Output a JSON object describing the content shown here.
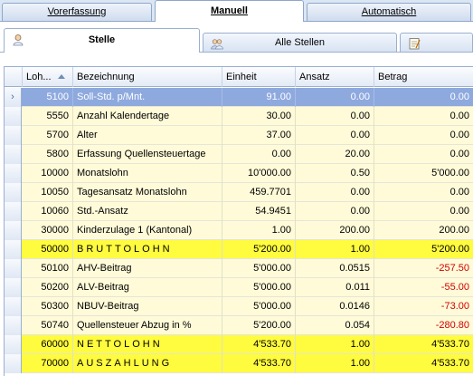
{
  "top_tabs": [
    {
      "label": "Vorerfassung",
      "active": false
    },
    {
      "label": "Manuell",
      "active": true
    },
    {
      "label": "Automatisch",
      "active": false
    }
  ],
  "sub_tabs": [
    {
      "label": "Stelle",
      "icon": "person-icon",
      "active": true
    },
    {
      "label": "Alle Stellen",
      "icon": "people-icon",
      "active": false
    },
    {
      "label": "",
      "icon": "notepad-icon",
      "active": false
    }
  ],
  "columns": [
    "Loh...",
    "Bezeichnung",
    "Einheit",
    "Ansatz",
    "Betrag"
  ],
  "row_indicator": "›",
  "rows": [
    {
      "code": "5100",
      "name": "Soll-Std. p/Mnt.",
      "einheit": "91.00",
      "ansatz": "0.00",
      "betrag": "0.00",
      "type": "selected"
    },
    {
      "code": "5550",
      "name": "Anzahl Kalendertage",
      "einheit": "30.00",
      "ansatz": "0.00",
      "betrag": "0.00",
      "type": "normal"
    },
    {
      "code": "5700",
      "name": "Alter",
      "einheit": "37.00",
      "ansatz": "0.00",
      "betrag": "0.00",
      "type": "normal"
    },
    {
      "code": "5800",
      "name": "Erfassung Quellensteuertage",
      "einheit": "0.00",
      "ansatz": "20.00",
      "betrag": "0.00",
      "type": "normal"
    },
    {
      "code": "10000",
      "name": "Monatslohn",
      "einheit": "10'000.00",
      "ansatz": "0.50",
      "betrag": "5'000.00",
      "type": "normal"
    },
    {
      "code": "10050",
      "name": "Tagesansatz Monatslohn",
      "einheit": "459.7701",
      "ansatz": "0.00",
      "betrag": "0.00",
      "type": "normal"
    },
    {
      "code": "10060",
      "name": "Std.-Ansatz",
      "einheit": "54.9451",
      "ansatz": "0.00",
      "betrag": "0.00",
      "type": "normal"
    },
    {
      "code": "30000",
      "name": "Kinderzulage 1 (Kantonal)",
      "einheit": "1.00",
      "ansatz": "200.00",
      "betrag": "200.00",
      "type": "normal"
    },
    {
      "code": "50000",
      "name": "BRUTTOLOHN",
      "einheit": "5'200.00",
      "ansatz": "1.00",
      "betrag": "5'200.00",
      "type": "total"
    },
    {
      "code": "50100",
      "name": "AHV-Beitrag",
      "einheit": "5'000.00",
      "ansatz": "0.0515",
      "betrag": "-257.50",
      "type": "normal",
      "neg": true
    },
    {
      "code": "50200",
      "name": "ALV-Beitrag",
      "einheit": "5'000.00",
      "ansatz": "0.011",
      "betrag": "-55.00",
      "type": "normal",
      "neg": true
    },
    {
      "code": "50300",
      "name": "NBUV-Beitrag",
      "einheit": "5'000.00",
      "ansatz": "0.0146",
      "betrag": "-73.00",
      "type": "normal",
      "neg": true
    },
    {
      "code": "50740",
      "name": "Quellensteuer Abzug in %",
      "einheit": "5'200.00",
      "ansatz": "0.054",
      "betrag": "-280.80",
      "type": "normal",
      "neg": true
    },
    {
      "code": "60000",
      "name": "NETTOLOHN",
      "einheit": "4'533.70",
      "ansatz": "1.00",
      "betrag": "4'533.70",
      "type": "total"
    },
    {
      "code": "70000",
      "name": "AUSZAHLUNG",
      "einheit": "4'533.70",
      "ansatz": "1.00",
      "betrag": "4'533.70",
      "type": "total"
    }
  ]
}
